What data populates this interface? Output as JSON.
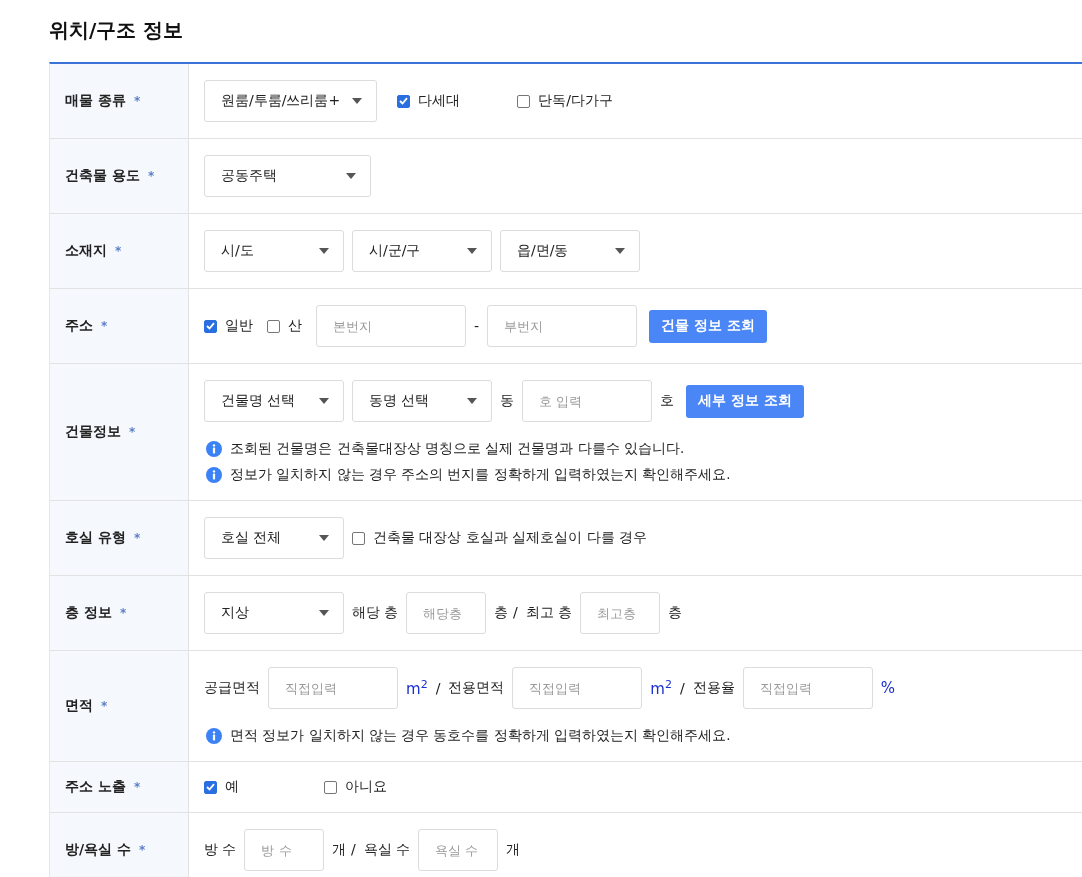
{
  "title": "위치/구조 정보",
  "rows": [
    {
      "label": "매물 종류",
      "mark": "*",
      "controls": [
        {
          "kind": "select",
          "value": "원룸/투룸/쓰리룸+"
        },
        {
          "kind": "option",
          "label": "다세대",
          "checked": true
        },
        {
          "kind": "option",
          "label": "단독/다가구",
          "checked": false
        }
      ]
    },
    {
      "label": "건축물 용도",
      "mark": "*",
      "controls": [
        {
          "kind": "select",
          "value": "공동주택"
        }
      ]
    },
    {
      "label": "소재지",
      "mark": "*",
      "controls": [
        {
          "kind": "select",
          "value": "시/도"
        },
        {
          "kind": "select",
          "value": "시/군/구"
        },
        {
          "kind": "select",
          "value": "읍/면/동"
        }
      ]
    },
    {
      "label": "주소",
      "mark": "*",
      "controls": [
        {
          "kind": "checkbox",
          "label": "일반",
          "checked": true
        },
        {
          "kind": "checkbox",
          "label": "산",
          "checked": false
        },
        {
          "kind": "input",
          "placeholder": "본번지"
        },
        {
          "kind": "text",
          "text": "-"
        },
        {
          "kind": "input",
          "placeholder": "부번지"
        },
        {
          "kind": "button",
          "label": "건물 정보 조회"
        }
      ]
    },
    {
      "label": "건물정보",
      "mark": "*",
      "controls": [
        {
          "kind": "select",
          "value": "건물명 선택"
        },
        {
          "kind": "select",
          "value": "동명 선택"
        },
        {
          "kind": "text",
          "text": "동"
        },
        {
          "kind": "input",
          "placeholder": "호 입력"
        },
        {
          "kind": "text",
          "text": "호"
        },
        {
          "kind": "button",
          "label": "세부 정보 조회"
        }
      ],
      "notes": [
        "조회된 건물명은 건축물대장상 명칭으로 실제 건물명과 다를수 있습니다.",
        "정보가 일치하지 않는 경우 주소의 번지를 정확하게 입력하였는지 확인해주세요."
      ]
    },
    {
      "label": "호실 유형",
      "mark": "*",
      "controls": [
        {
          "kind": "select",
          "value": "호실 전체"
        },
        {
          "kind": "checkbox",
          "label": "건축물 대장상 호실과 실제호실이 다를 경우",
          "checked": false
        }
      ]
    },
    {
      "label": "층 정보",
      "mark": "*",
      "controls": [
        {
          "kind": "select",
          "value": "지상"
        },
        {
          "kind": "text",
          "text": "해당 층"
        },
        {
          "kind": "input",
          "placeholder": "해당층"
        },
        {
          "kind": "text",
          "text": "층 /"
        },
        {
          "kind": "text",
          "text": "최고 층"
        },
        {
          "kind": "input",
          "placeholder": "최고층"
        },
        {
          "kind": "text",
          "text": "층"
        }
      ]
    },
    {
      "label": "면적",
      "mark": "*",
      "controls": [
        {
          "kind": "text",
          "text": "공급면적"
        },
        {
          "kind": "input",
          "placeholder": "직접입력"
        },
        {
          "kind": "unit",
          "text": "m$^{2}$"
        },
        {
          "kind": "text",
          "text": "/"
        },
        {
          "kind": "text",
          "text": "전용면적"
        },
        {
          "kind": "input",
          "placeholder": "직접입력"
        },
        {
          "kind": "unit",
          "text": "m$^{2}$"
        },
        {
          "kind": "text",
          "text": "/"
        },
        {
          "kind": "text",
          "text": "전용율"
        },
        {
          "kind": "input",
          "placeholder": "직접입력"
        },
        {
          "kind": "unit",
          "text": "%"
        }
      ],
      "notes": [
        "면적 정보가 일치하지 않는 경우 동호수를 정확하게 입력하였는지 확인해주세요."
      ]
    },
    {
      "label": "주소 노출",
      "mark": "*",
      "controls": [
        {
          "kind": "option",
          "label": "예",
          "checked": true
        },
        {
          "kind": "option",
          "label": "아니요",
          "checked": false
        }
      ]
    },
    {
      "label": "방/욕실 수",
      "mark": "*",
      "controls": [
        {
          "kind": "text",
          "text": "방 수"
        },
        {
          "kind": "input",
          "placeholder": "방 수"
        },
        {
          "kind": "text",
          "text": "개 /"
        },
        {
          "kind": "text",
          "text": "욕실 수"
        },
        {
          "kind": "input",
          "placeholder": "욕실 수"
        },
        {
          "kind": "text",
          "text": "개"
        }
      ]
    }
  ]
}
